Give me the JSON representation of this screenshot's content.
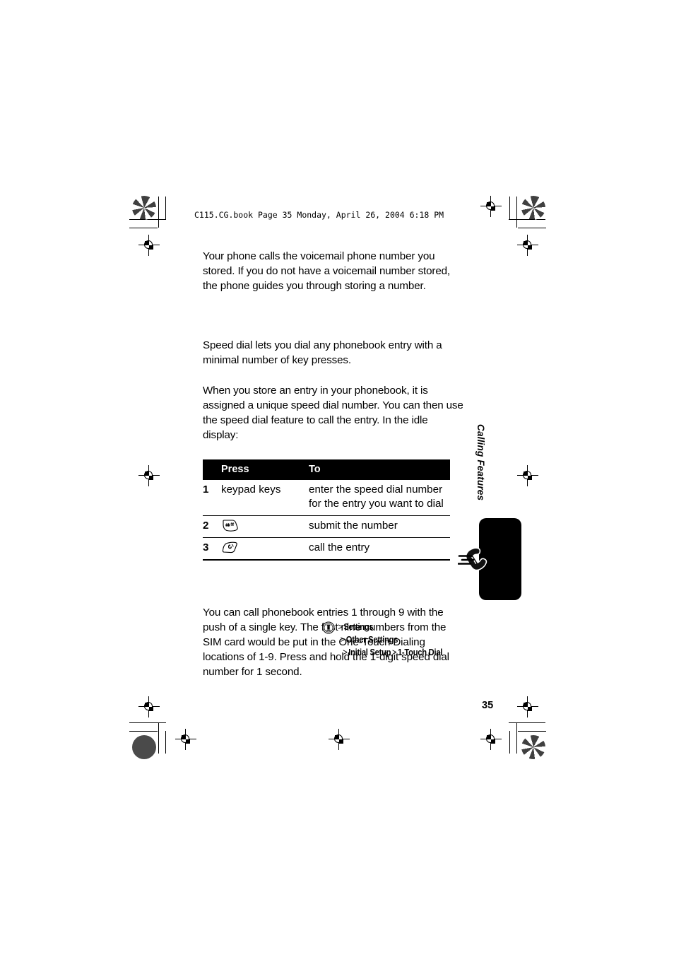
{
  "document": {
    "header_line": "C115.CG.book  Page 35  Monday, April 26, 2004  6:18 PM",
    "page_number": "35",
    "side_tab_label": "Calling Features"
  },
  "paragraphs": {
    "voicemail": "Your phone calls the voicemail phone number you stored. If you do not have a voicemail number stored, the phone guides you through storing a number.",
    "speed_dial_intro": "Speed dial lets you dial any phonebook entry with a minimal number of key presses.",
    "speed_dial_detail": "When you store an entry in your phonebook, it is assigned a unique speed dial number. You can then use the speed dial feature to call the entry. In the idle display:",
    "one_touch": "You can call phonebook entries 1 through 9 with the push of a single key. The first nine numbers from the SIM card would be put in the One-Touch Dialing locations of 1-9. Press and hold the 1-digit speed dial number for 1 second."
  },
  "table": {
    "headers": {
      "number": "",
      "press": "Press",
      "to": "To"
    },
    "rows": [
      {
        "number": "1",
        "press_text": "keypad keys",
        "press_icon": "",
        "to": "enter the speed dial number for the entry you want to dial"
      },
      {
        "number": "2",
        "press_text": "",
        "press_icon": "pound-key-icon",
        "to": "submit the number"
      },
      {
        "number": "3",
        "press_text": "",
        "press_icon": "send-key-icon",
        "to": "call the entry"
      }
    ]
  },
  "menu_path": {
    "icon": "menu-button-icon",
    "rows": [
      {
        "sep": ">",
        "label": "Settings"
      },
      {
        "sep": ">",
        "label": "Other Settings"
      },
      {
        "sep": ">",
        "label": "Initial Setup",
        "sep2": ">",
        "label2": "1-Touch Dial"
      }
    ]
  },
  "colors": {
    "ink": "#000000",
    "paper": "#ffffff",
    "header_bar": "#000000",
    "header_text": "#ffffff"
  }
}
